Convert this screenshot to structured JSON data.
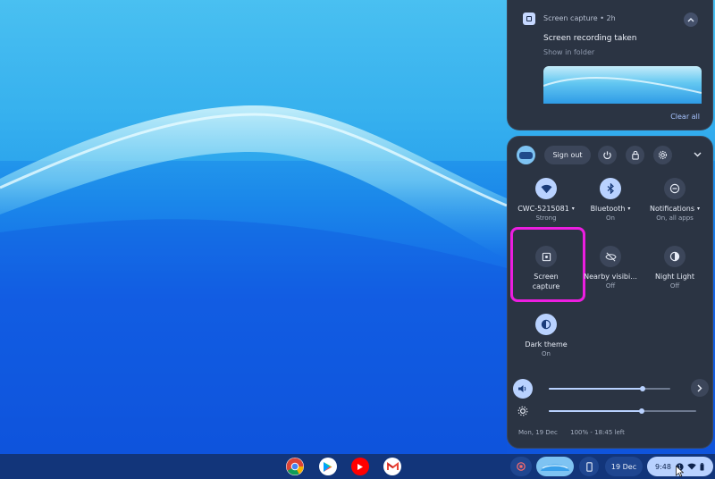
{
  "notification": {
    "app_name": "Screen capture",
    "time": "2h",
    "separator": "•",
    "title": "Screen recording taken",
    "action": "Show in folder",
    "clear_all": "Clear all"
  },
  "quick_settings": {
    "sign_out": "Sign out",
    "tiles": [
      {
        "label": "CWC-5215081",
        "sub": "Strong",
        "icon": "wifi-icon",
        "on": true,
        "caret": "▾"
      },
      {
        "label": "Bluetooth",
        "sub": "On",
        "icon": "bluetooth-icon",
        "on": true,
        "caret": "▾"
      },
      {
        "label": "Notifications",
        "sub": "On, all apps",
        "icon": "notifications-icon",
        "on": false,
        "caret": "▾"
      },
      {
        "label": "Screen",
        "label2": "capture",
        "sub": "",
        "icon": "screen-capture-icon",
        "on": false
      },
      {
        "label": "Nearby visibi...",
        "sub": "Off",
        "icon": "nearby-share-icon",
        "on": false
      },
      {
        "label": "Night Light",
        "sub": "Off",
        "icon": "night-light-icon",
        "on": false
      },
      {
        "label": "Dark theme",
        "sub": "On",
        "icon": "dark-theme-icon",
        "on": false
      }
    ],
    "volume_level": 0.77,
    "brightness_level": 0.63,
    "date": "Mon, 19 Dec",
    "battery": "100% - 18:45 left"
  },
  "shelf": {
    "apps": [
      "chrome-icon",
      "play-store-icon",
      "youtube-icon",
      "gmail-icon"
    ],
    "date": "19 Dec",
    "time": "9:48"
  },
  "colors": {
    "highlight": "#ec1ee0",
    "accent": "#b9d2ff",
    "panel": "#2b3443"
  }
}
